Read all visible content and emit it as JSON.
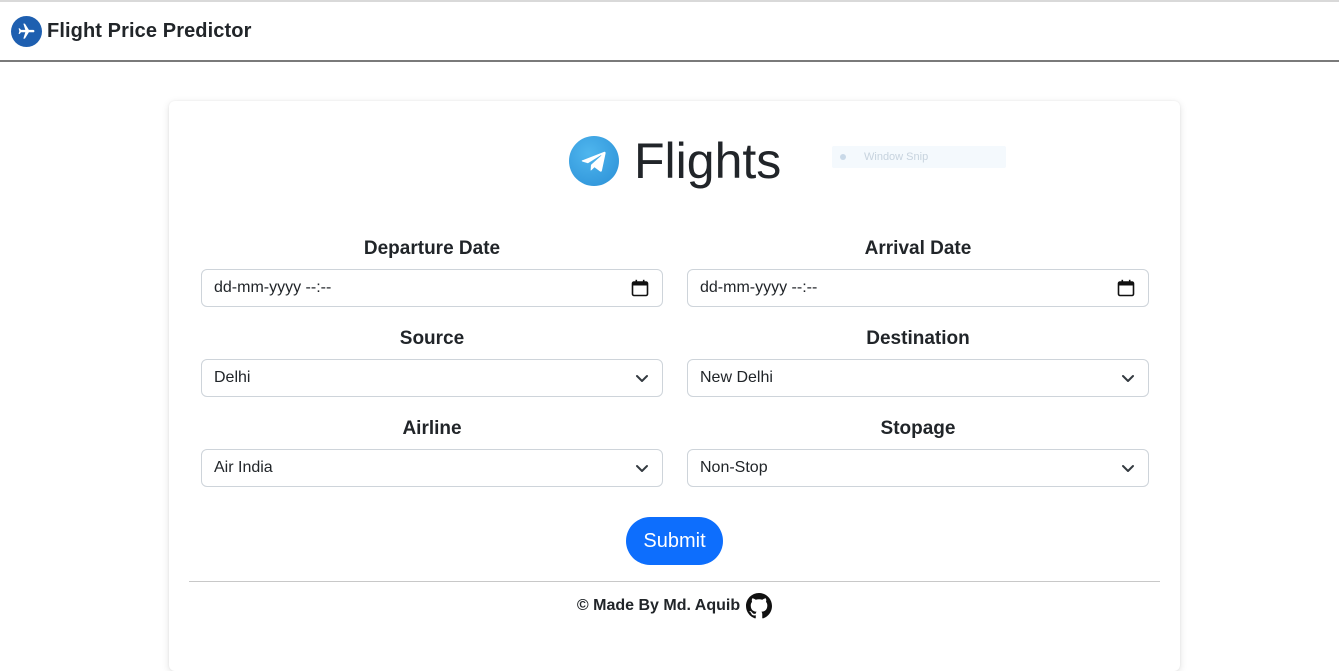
{
  "navbar": {
    "brand_icon": "airplane-icon",
    "brand_title": "Flight Price Predictor"
  },
  "card": {
    "heading_icon": "telegram-icon",
    "heading": "Flights",
    "ghost_overlay": "Window Snip"
  },
  "form": {
    "departure": {
      "label": "Departure Date",
      "placeholder": "dd-mm-yyyy --:--",
      "icon": "calendar-icon"
    },
    "arrival": {
      "label": "Arrival Date",
      "placeholder": "dd-mm-yyyy --:--",
      "icon": "calendar-icon"
    },
    "source": {
      "label": "Source",
      "value": "Delhi",
      "icon": "chevron-down-icon"
    },
    "destination": {
      "label": "Destination",
      "value": "New Delhi",
      "icon": "chevron-down-icon"
    },
    "airline": {
      "label": "Airline",
      "value": "Air India",
      "icon": "chevron-down-icon"
    },
    "stopage": {
      "label": "Stopage",
      "value": "Non-Stop",
      "icon": "chevron-down-icon"
    },
    "submit_label": "Submit"
  },
  "footer": {
    "text": "© Made By Md. Aquib",
    "icon": "github-icon"
  },
  "colors": {
    "primary": "#0d6efd",
    "brand_icon_bg": "#1e5fb0",
    "heading_icon_bg": "#2a8fd6",
    "navbar_border": "#7a7a7a"
  }
}
